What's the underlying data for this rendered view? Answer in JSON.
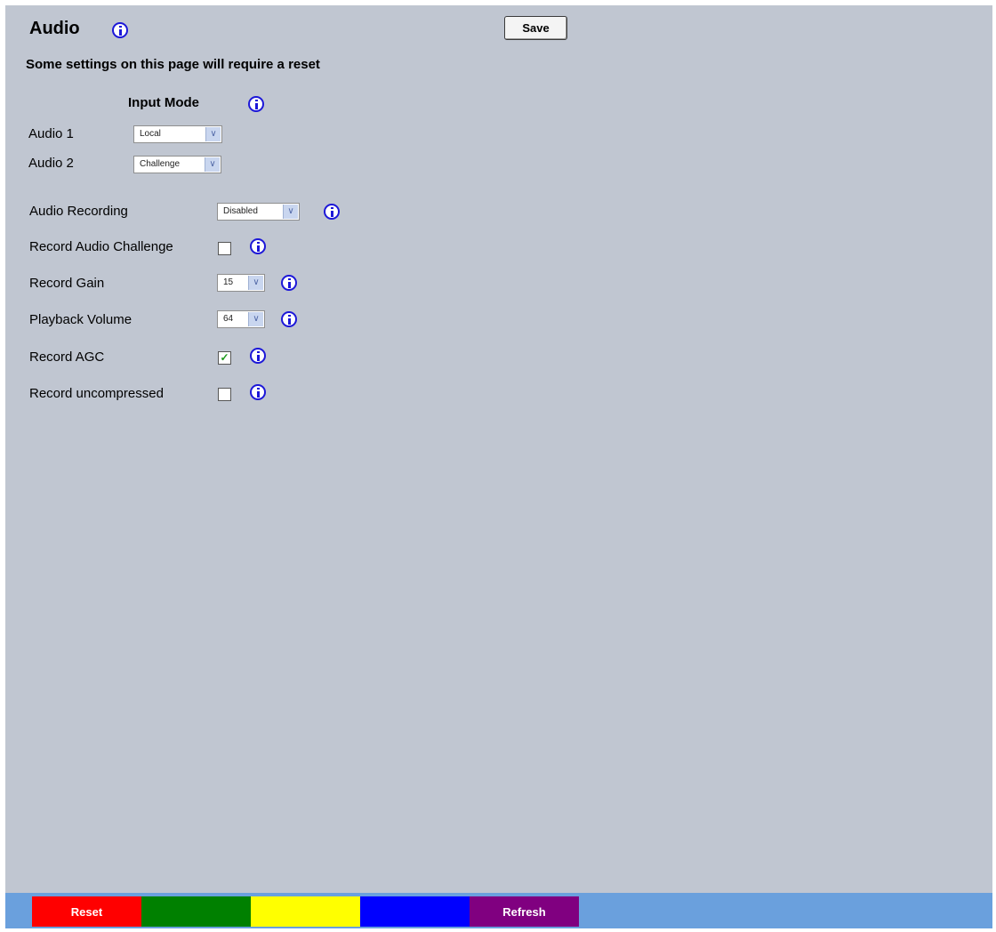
{
  "header": {
    "title": "Audio",
    "save_label": "Save",
    "notice": "Some settings on this page will require a reset"
  },
  "input_mode": {
    "heading": "Input Mode",
    "rows": [
      {
        "label": "Audio 1",
        "value": "Local"
      },
      {
        "label": "Audio 2",
        "value": "Challenge"
      }
    ]
  },
  "settings": {
    "audio_recording": {
      "label": "Audio Recording",
      "value": "Disabled"
    },
    "record_audio_challenge": {
      "label": "Record Audio Challenge",
      "checked": false
    },
    "record_gain": {
      "label": "Record Gain",
      "value": "15"
    },
    "playback_volume": {
      "label": "Playback Volume",
      "value": "64"
    },
    "record_agc": {
      "label": "Record AGC",
      "checked": true
    },
    "record_uncompressed": {
      "label": "Record uncompressed",
      "checked": false
    }
  },
  "icons": {
    "info": "info-icon",
    "dropdown_arrow": "chevron-down-icon",
    "check": "checkmark-icon"
  },
  "glyphs": {
    "arrow": "∨",
    "check": "✓"
  },
  "bottom_bar": {
    "buttons": [
      {
        "label": "Reset",
        "color": "#ff0000"
      },
      {
        "label": "",
        "color": "#008000"
      },
      {
        "label": "",
        "color": "#ffff00"
      },
      {
        "label": "",
        "color": "#0000ff"
      },
      {
        "label": "Refresh",
        "color": "#800080"
      }
    ],
    "bar_color": "#6aa0dd"
  },
  "colors": {
    "panel_background": "#c0c6d1",
    "info_icon": "#1c17d8"
  }
}
